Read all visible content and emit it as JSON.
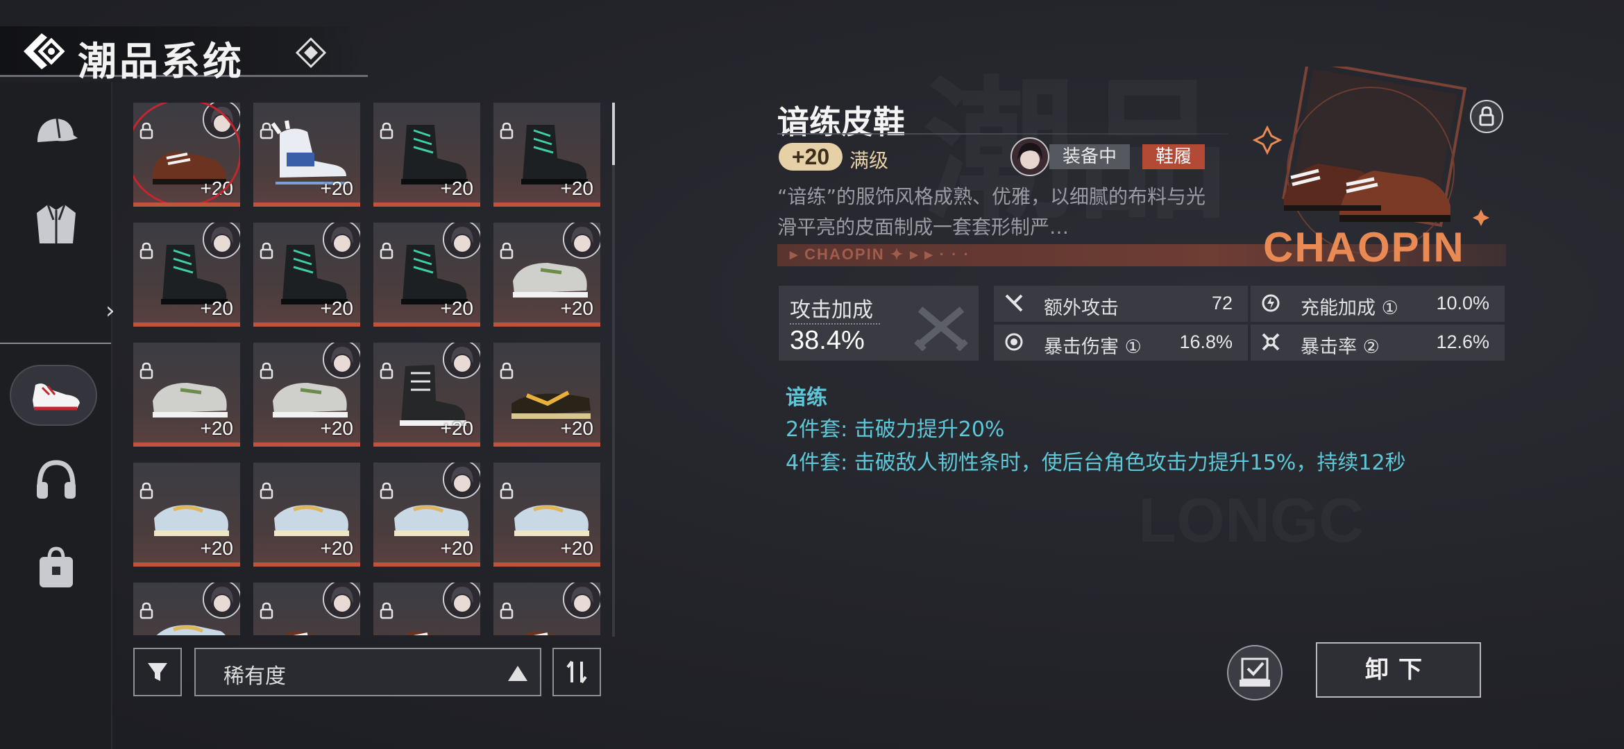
{
  "header": {
    "title": "潮品系统"
  },
  "sidebar": {
    "items": [
      {
        "icon": "cap-icon"
      },
      {
        "icon": "jacket-icon"
      },
      {
        "icon": "sneaker-icon",
        "active": true
      },
      {
        "icon": "headphones-icon"
      },
      {
        "icon": "bag-icon"
      }
    ]
  },
  "grid": {
    "items": [
      {
        "shoe": "brown-leather",
        "level": "+20",
        "avatar": true,
        "selected": true
      },
      {
        "shoe": "white-skate",
        "level": "+20",
        "avatar": false
      },
      {
        "shoe": "black-boot",
        "level": "+20",
        "avatar": false
      },
      {
        "shoe": "black-boot",
        "level": "+20",
        "avatar": false
      },
      {
        "shoe": "black-boot",
        "level": "+20",
        "avatar": true
      },
      {
        "shoe": "black-boot",
        "level": "+20",
        "avatar": true
      },
      {
        "shoe": "black-boot",
        "level": "+20",
        "avatar": true
      },
      {
        "shoe": "grey-slipon",
        "level": "+20",
        "avatar": true
      },
      {
        "shoe": "grey-slipon",
        "level": "+20",
        "avatar": false
      },
      {
        "shoe": "grey-slipon",
        "level": "+20",
        "avatar": true
      },
      {
        "shoe": "hightop-black",
        "level": "+20",
        "avatar": true
      },
      {
        "shoe": "gold-sandal",
        "level": "+20",
        "avatar": false
      },
      {
        "shoe": "blue-flat",
        "level": "+20",
        "avatar": false
      },
      {
        "shoe": "blue-flat",
        "level": "+20",
        "avatar": false
      },
      {
        "shoe": "blue-flat",
        "level": "+20",
        "avatar": true
      },
      {
        "shoe": "blue-flat",
        "level": "+20",
        "avatar": false
      },
      {
        "shoe": "blue-flat",
        "level": "",
        "avatar": true
      },
      {
        "shoe": "brown-leather",
        "level": "",
        "avatar": true
      },
      {
        "shoe": "brown-leather",
        "level": "",
        "avatar": true
      },
      {
        "shoe": "brown-leather",
        "level": "",
        "avatar": true
      }
    ]
  },
  "filter": {
    "sort_label": "稀有度"
  },
  "detail": {
    "name": "谙练皮鞋",
    "level": "+20",
    "max_label": "满级",
    "equipped_label": "装备中",
    "slot_label": "鞋履",
    "description": "“谙练”的服饰风格成熟、优雅，以细腻的布料与光滑平亮的皮面制成一套套形制严…",
    "band_text": "▸ CHAOPIN ✦ ▸ ▸ · · ·",
    "brand_art_text": "CHAOPIN",
    "main_stat": {
      "label": "攻击加成",
      "value": "38.4%"
    },
    "sub_stats": [
      {
        "icon": "extra-attack-icon",
        "label": "额外攻击",
        "value": "72"
      },
      {
        "icon": "energy-icon",
        "label": "充能加成 ①",
        "value": "10.0%"
      },
      {
        "icon": "crit-damage-icon",
        "label": "暴击伤害 ①",
        "value": "16.8%"
      },
      {
        "icon": "crit-rate-icon",
        "label": "暴击率 ②",
        "value": "12.6%"
      }
    ],
    "set": {
      "name": "谙练",
      "bonus2": "2件套: 击破力提升20%",
      "bonus4": "4件套: 击破敌人韧性条时，使后台角色攻击力提升15%，持续12秒"
    },
    "unequip_label": "卸下"
  },
  "colors": {
    "accent_cyan": "#5ec8d8",
    "accent_orange": "#e98a55",
    "badge_gold": "#e6d0a8",
    "slot_red": "#b34a36"
  }
}
